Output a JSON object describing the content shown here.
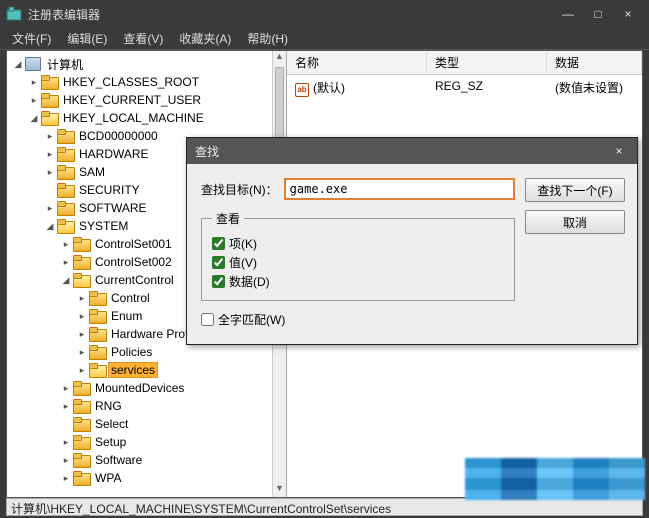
{
  "window": {
    "title": "注册表编辑器",
    "min": "—",
    "max": "□",
    "close": "×"
  },
  "menu": {
    "file": "文件(F)",
    "edit": "编辑(E)",
    "view": "查看(V)",
    "favorites": "收藏夹(A)",
    "help": "帮助(H)"
  },
  "tree": {
    "root": "计算机",
    "hkcr": "HKEY_CLASSES_ROOT",
    "hkcu": "HKEY_CURRENT_USER",
    "hklm": "HKEY_LOCAL_MACHINE",
    "bcd": "BCD00000000",
    "hardware": "HARDWARE",
    "sam": "SAM",
    "security": "SECURITY",
    "software": "SOFTWARE",
    "system": "SYSTEM",
    "cs001": "ControlSet001",
    "cs002": "ControlSet002",
    "ccs": "CurrentControl",
    "control": "Control",
    "enum": "Enum",
    "hwp": "Hardware Profiles",
    "policies": "Policies",
    "services": "services",
    "mounted": "MountedDevices",
    "rng": "RNG",
    "select": "Select",
    "setup": "Setup",
    "software2": "Software",
    "wpa": "WPA"
  },
  "list": {
    "hdr_name": "名称",
    "hdr_type": "类型",
    "hdr_data": "数据",
    "row_name": "(默认)",
    "row_type": "REG_SZ",
    "row_data": "(数值未设置)",
    "ab": "ab"
  },
  "status": {
    "path": "计算机\\HKEY_LOCAL_MACHINE\\SYSTEM\\CurrentControlSet\\services"
  },
  "dialog": {
    "title": "查找",
    "target_label": "查找目标(N)：",
    "target_value": "game.exe",
    "group": "查看",
    "keys": "项(K)",
    "values": "值(V)",
    "data": "数据(D)",
    "whole": "全字匹配(W)",
    "findnext": "查找下一个(F)",
    "cancel": "取消"
  }
}
